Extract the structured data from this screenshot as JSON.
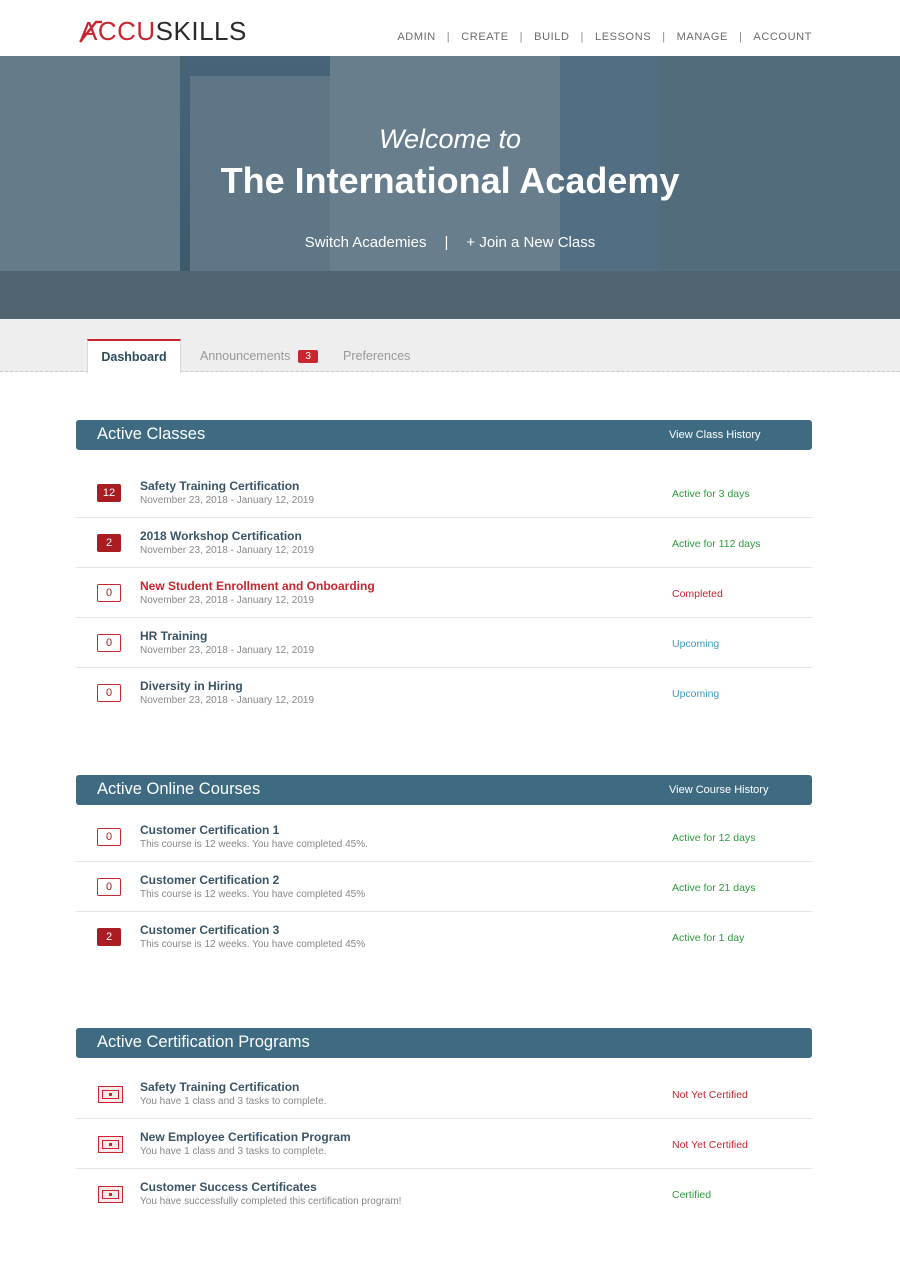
{
  "brand": {
    "logo_accu": "ACCU",
    "logo_skills": "SKILLS"
  },
  "nav": [
    {
      "label": "ADMIN"
    },
    {
      "label": "CREATE"
    },
    {
      "label": "BUILD"
    },
    {
      "label": "LESSONS"
    },
    {
      "label": "MANAGE"
    },
    {
      "label": "ACCOUNT"
    }
  ],
  "hero": {
    "welcome": "Welcome to",
    "title": "The International Academy",
    "switch_label": "Switch Academies",
    "join_label": "+ Join a New Class"
  },
  "tabs": {
    "dashboard": "Dashboard",
    "announcements": "Announcements",
    "announcements_count": "3",
    "preferences": "Preferences"
  },
  "classes": {
    "title": "Active Classes",
    "history_link": "View Class History",
    "items": [
      {
        "count": "12",
        "title": "Safety Training Certification",
        "dates": "November 23, 2018 - January 12, 2019",
        "status": "Active for 3 days"
      },
      {
        "count": "2",
        "title": "2018 Workshop Certification",
        "dates": "November 23, 2018 - January 12, 2019",
        "status": "Active for 112 days"
      },
      {
        "count": "0",
        "title": "New Student Enrollment and Onboarding",
        "dates": "November 23, 2018 - January 12, 2019",
        "status": "Completed"
      },
      {
        "count": "0",
        "title": "HR Training",
        "dates": "November 23, 2018 - January 12, 2019",
        "status": "Upcoming"
      },
      {
        "count": "0",
        "title": "Diversity in Hiring",
        "dates": "November 23, 2018 - January 12, 2019",
        "status": "Upcoming"
      }
    ]
  },
  "courses": {
    "title": "Active Online Courses",
    "history_link": "View Course History",
    "items": [
      {
        "count": "0",
        "title": "Customer Certification 1",
        "desc": "This course is 12 weeks. You have completed 45%.",
        "status": "Active for 12 days"
      },
      {
        "count": "0",
        "title": "Customer Certification 2",
        "desc": "This course is 12 weeks. You have completed 45%",
        "status": "Active for 21 days"
      },
      {
        "count": "2",
        "title": "Customer Certification 3",
        "desc": "This course is 12 weeks. You have completed 45%",
        "status": "Active for 1 day"
      }
    ]
  },
  "programs": {
    "title": "Active Certification Programs",
    "items": [
      {
        "title": "Safety Training Certification",
        "desc": "You have 1 class and 3 tasks to complete.",
        "status": "Not Yet Certified"
      },
      {
        "title": "New Employee Certification Program",
        "desc": "You have 1 class and 3 tasks to complete.",
        "status": "Not Yet Certified"
      },
      {
        "title": "Customer Success Certificates",
        "desc": "You have successfully completed this certification program!",
        "status": "Certified"
      }
    ]
  },
  "colors": {
    "accent_red": "#c9252f",
    "header_blue": "#3f6b82",
    "status_green": "#2f9a3f",
    "status_blue": "#3e9ac4"
  }
}
